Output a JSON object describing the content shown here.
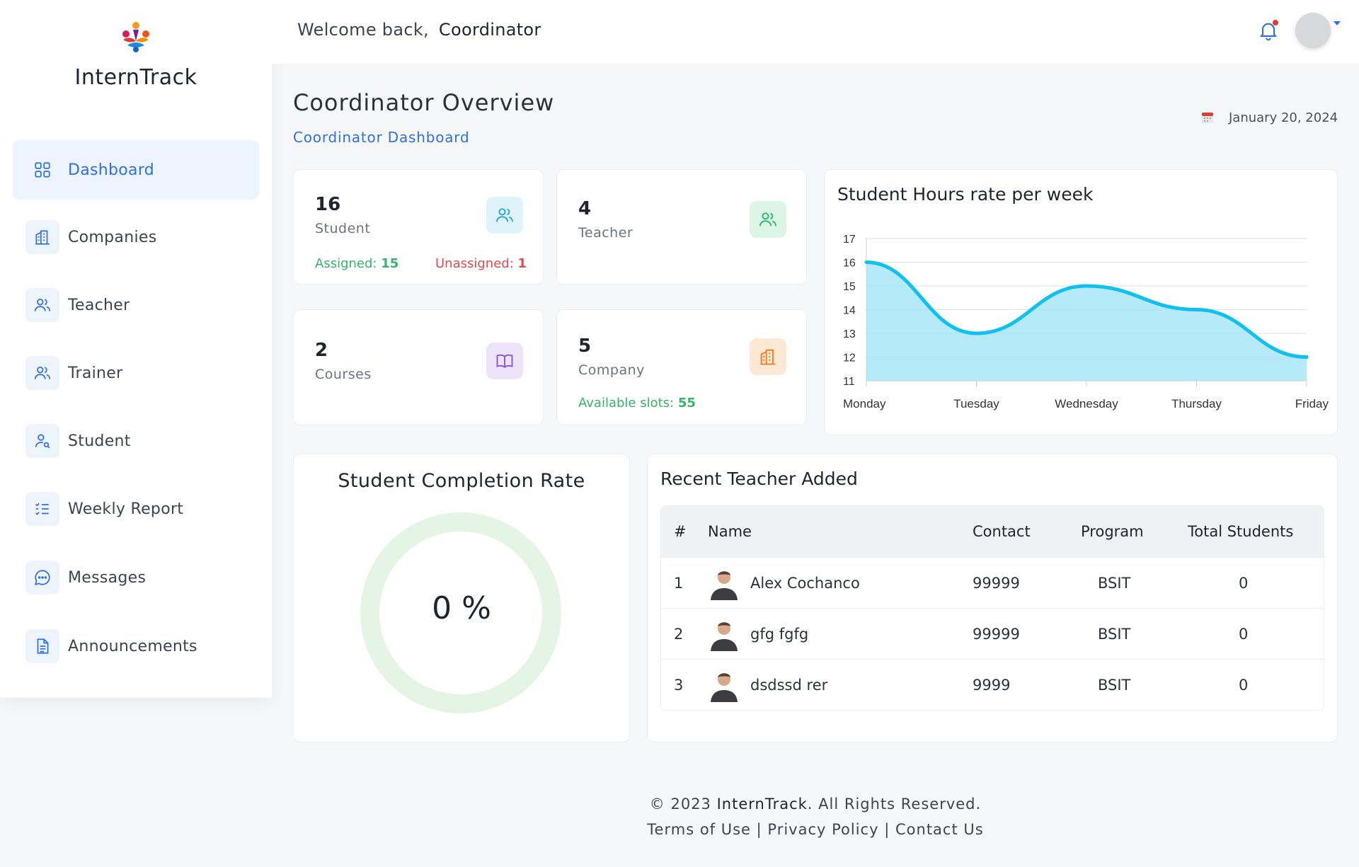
{
  "app": {
    "brand": "InternTrack"
  },
  "header": {
    "welcome": "Welcome back,",
    "user": "Coordinator"
  },
  "sidebar": {
    "items": [
      {
        "label": "Dashboard",
        "icon": "grid-icon",
        "active": true
      },
      {
        "label": "Companies",
        "icon": "building-icon"
      },
      {
        "label": "Teacher",
        "icon": "users-icon"
      },
      {
        "label": "Trainer",
        "icon": "users-icon"
      },
      {
        "label": "Student",
        "icon": "user-search-icon"
      },
      {
        "label": "Weekly Report",
        "icon": "checklist-icon"
      },
      {
        "label": "Messages",
        "icon": "chat-icon"
      },
      {
        "label": "Announcements",
        "icon": "document-icon"
      }
    ]
  },
  "page": {
    "title": "Coordinator Overview",
    "subtitle": "Coordinator Dashboard",
    "date": "January 20, 2024"
  },
  "stats": {
    "student": {
      "value": "16",
      "label": "Student",
      "assigned_label": "Assigned:",
      "assigned": "15",
      "unassigned_label": "Unassigned:",
      "unassigned": "1"
    },
    "teacher": {
      "value": "4",
      "label": "Teacher"
    },
    "courses": {
      "value": "2",
      "label": "Courses"
    },
    "company": {
      "value": "5",
      "label": "Company",
      "slots_label": "Available slots:",
      "slots": "55"
    }
  },
  "chart_data": {
    "type": "area",
    "title": "Student Hours rate per week",
    "categories": [
      "Monday",
      "Tuesday",
      "Wednesday",
      "Thursday",
      "Friday"
    ],
    "series": [
      {
        "values": [
          16,
          13,
          15,
          14,
          12
        ]
      }
    ],
    "ylim": [
      11,
      17
    ],
    "yticks": [
      "17",
      "16",
      "15",
      "14",
      "13",
      "12",
      "11"
    ],
    "grid": true,
    "colors": {
      "line": "#10c0ef",
      "fill": "#a9e6f7"
    }
  },
  "completion": {
    "title": "Student Completion Rate",
    "value_text": "0 %",
    "ring_color": "#e4f5e6"
  },
  "recent_teachers": {
    "title": "Recent Teacher Added",
    "columns": [
      "#",
      "Name",
      "Contact",
      "Program",
      "Total Students"
    ],
    "rows": [
      {
        "num": "1",
        "name": "Alex Cochanco",
        "contact": "99999",
        "program": "BSIT",
        "total": "0"
      },
      {
        "num": "2",
        "name": "gfg fgfg",
        "contact": "99999",
        "program": "BSIT",
        "total": "0"
      },
      {
        "num": "3",
        "name": "dsdssd rer",
        "contact": "9999",
        "program": "BSIT",
        "total": "0"
      }
    ]
  },
  "footer": {
    "copyright_prefix": "© 2023",
    "brand": "InternTrack",
    "copyright_suffix": ". All Rights Reserved.",
    "links": [
      "Terms of Use",
      "Privacy Policy",
      "Contact Us"
    ],
    "separator": "|"
  }
}
